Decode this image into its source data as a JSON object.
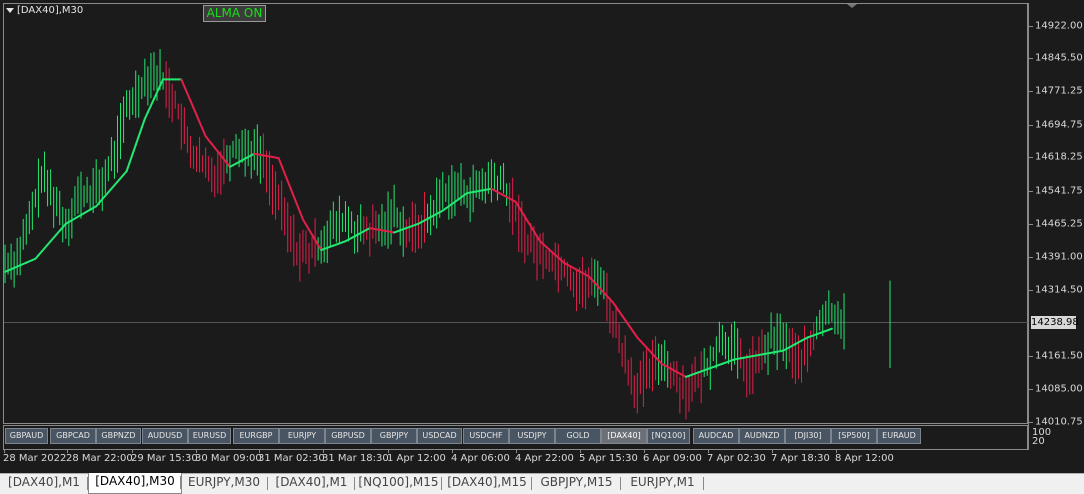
{
  "window": {
    "title": "[DAX40],M30"
  },
  "indicator_button": {
    "label": "ALMA ON",
    "color": "#18e018"
  },
  "current_price": "14238.98",
  "subwindow_levels": [
    "100",
    "20"
  ],
  "colors": {
    "background": "#1b1b1b",
    "bull": "#22e870",
    "bear": "#e0204a",
    "axis_text": "#d8d8d8"
  },
  "symbol_buttons": [
    "GBPAUD",
    "GBPCAD",
    "GBPNZD",
    "AUDUSD",
    "EURUSD",
    "EURGBP",
    "EURJPY",
    "GBPUSD",
    "GBPJPY",
    "USDCAD",
    "USDCHF",
    "USDJPY",
    "GOLD",
    "[DAX40]",
    "[NQ100]",
    "AUDCAD",
    "AUDNZD",
    "[DJI30]",
    "[SP500]",
    "EURAUD"
  ],
  "active_symbol": "[DAX40]",
  "tabs": [
    "[DAX40],M1",
    "[DAX40],M30",
    "EURJPY,M30",
    "[DAX40],M1",
    "[NQ100],M15",
    "[DAX40],M15",
    "GBPJPY,M15",
    "EURJPY,M1"
  ],
  "active_tab": "[DAX40],M30",
  "chart_data": {
    "type": "line",
    "title": "[DAX40],M30",
    "yticks": [
      "14922.00",
      "14845.50",
      "14771.25",
      "14694.75",
      "14618.25",
      "14541.75",
      "14465.25",
      "14391.00",
      "14314.50",
      "14238.98",
      "14161.50",
      "14085.00",
      "14010.75"
    ],
    "y_axis_range": [
      14000,
      14960
    ],
    "x_tick_labels": [
      "28 Mar 2022",
      "28 Mar 22:00",
      "29 Mar 15:30",
      "30 Mar 09:00",
      "31 Mar 02:30",
      "31 Mar 18:30",
      "1 Apr 12:00",
      "4 Apr 06:00",
      "4 Apr 22:00",
      "5 Apr 15:30",
      "6 Apr 09:00",
      "7 Apr 02:30",
      "7 Apr 18:30",
      "8 Apr 12:00"
    ],
    "price_series": [
      {
        "i": 0,
        "v": 14370
      },
      {
        "i": 4,
        "v": 14380
      },
      {
        "i": 8,
        "v": 14460
      },
      {
        "i": 12,
        "v": 14570
      },
      {
        "i": 16,
        "v": 14520
      },
      {
        "i": 20,
        "v": 14460
      },
      {
        "i": 24,
        "v": 14520
      },
      {
        "i": 28,
        "v": 14530
      },
      {
        "i": 32,
        "v": 14550
      },
      {
        "i": 36,
        "v": 14620
      },
      {
        "i": 40,
        "v": 14720
      },
      {
        "i": 44,
        "v": 14770
      },
      {
        "i": 48,
        "v": 14810
      },
      {
        "i": 52,
        "v": 14790
      },
      {
        "i": 56,
        "v": 14740
      },
      {
        "i": 60,
        "v": 14640
      },
      {
        "i": 64,
        "v": 14600
      },
      {
        "i": 68,
        "v": 14570
      },
      {
        "i": 72,
        "v": 14600
      },
      {
        "i": 76,
        "v": 14640
      },
      {
        "i": 80,
        "v": 14630
      },
      {
        "i": 84,
        "v": 14620
      },
      {
        "i": 88,
        "v": 14550
      },
      {
        "i": 92,
        "v": 14470
      },
      {
        "i": 96,
        "v": 14400
      },
      {
        "i": 100,
        "v": 14390
      },
      {
        "i": 104,
        "v": 14420
      },
      {
        "i": 108,
        "v": 14450
      },
      {
        "i": 112,
        "v": 14470
      },
      {
        "i": 116,
        "v": 14440
      },
      {
        "i": 120,
        "v": 14440
      },
      {
        "i": 124,
        "v": 14450
      },
      {
        "i": 128,
        "v": 14490
      },
      {
        "i": 132,
        "v": 14440
      },
      {
        "i": 136,
        "v": 14450
      },
      {
        "i": 140,
        "v": 14480
      },
      {
        "i": 144,
        "v": 14530
      },
      {
        "i": 148,
        "v": 14540
      },
      {
        "i": 152,
        "v": 14530
      },
      {
        "i": 156,
        "v": 14540
      },
      {
        "i": 160,
        "v": 14560
      },
      {
        "i": 164,
        "v": 14550
      },
      {
        "i": 168,
        "v": 14480
      },
      {
        "i": 172,
        "v": 14420
      },
      {
        "i": 176,
        "v": 14390
      },
      {
        "i": 180,
        "v": 14380
      },
      {
        "i": 184,
        "v": 14360
      },
      {
        "i": 188,
        "v": 14320
      },
      {
        "i": 192,
        "v": 14320
      },
      {
        "i": 196,
        "v": 14340
      },
      {
        "i": 200,
        "v": 14240
      },
      {
        "i": 204,
        "v": 14150
      },
      {
        "i": 208,
        "v": 14080
      },
      {
        "i": 212,
        "v": 14120
      },
      {
        "i": 216,
        "v": 14160
      },
      {
        "i": 220,
        "v": 14110
      },
      {
        "i": 224,
        "v": 14080
      },
      {
        "i": 228,
        "v": 14100
      },
      {
        "i": 232,
        "v": 14150
      },
      {
        "i": 236,
        "v": 14200
      },
      {
        "i": 240,
        "v": 14170
      },
      {
        "i": 244,
        "v": 14120
      },
      {
        "i": 248,
        "v": 14150
      },
      {
        "i": 252,
        "v": 14190
      },
      {
        "i": 256,
        "v": 14200
      },
      {
        "i": 260,
        "v": 14150
      },
      {
        "i": 264,
        "v": 14160
      },
      {
        "i": 268,
        "v": 14240
      },
      {
        "i": 272,
        "v": 14260
      },
      {
        "i": 276,
        "v": 14240
      }
    ],
    "alma_series": [
      {
        "i": 0,
        "v": 14350
      },
      {
        "i": 10,
        "v": 14380
      },
      {
        "i": 20,
        "v": 14460
      },
      {
        "i": 30,
        "v": 14500
      },
      {
        "i": 40,
        "v": 14580
      },
      {
        "i": 46,
        "v": 14700
      },
      {
        "i": 52,
        "v": 14790
      },
      {
        "i": 58,
        "v": 14790
      },
      {
        "i": 66,
        "v": 14660
      },
      {
        "i": 74,
        "v": 14590
      },
      {
        "i": 82,
        "v": 14620
      },
      {
        "i": 90,
        "v": 14610
      },
      {
        "i": 98,
        "v": 14470
      },
      {
        "i": 104,
        "v": 14400
      },
      {
        "i": 112,
        "v": 14420
      },
      {
        "i": 120,
        "v": 14450
      },
      {
        "i": 128,
        "v": 14440
      },
      {
        "i": 136,
        "v": 14460
      },
      {
        "i": 144,
        "v": 14490
      },
      {
        "i": 152,
        "v": 14530
      },
      {
        "i": 160,
        "v": 14540
      },
      {
        "i": 168,
        "v": 14510
      },
      {
        "i": 176,
        "v": 14420
      },
      {
        "i": 184,
        "v": 14370
      },
      {
        "i": 192,
        "v": 14340
      },
      {
        "i": 200,
        "v": 14280
      },
      {
        "i": 208,
        "v": 14200
      },
      {
        "i": 216,
        "v": 14140
      },
      {
        "i": 224,
        "v": 14110
      },
      {
        "i": 232,
        "v": 14130
      },
      {
        "i": 240,
        "v": 14150
      },
      {
        "i": 248,
        "v": 14160
      },
      {
        "i": 256,
        "v": 14170
      },
      {
        "i": 264,
        "v": 14200
      },
      {
        "i": 272,
        "v": 14220
      }
    ]
  }
}
